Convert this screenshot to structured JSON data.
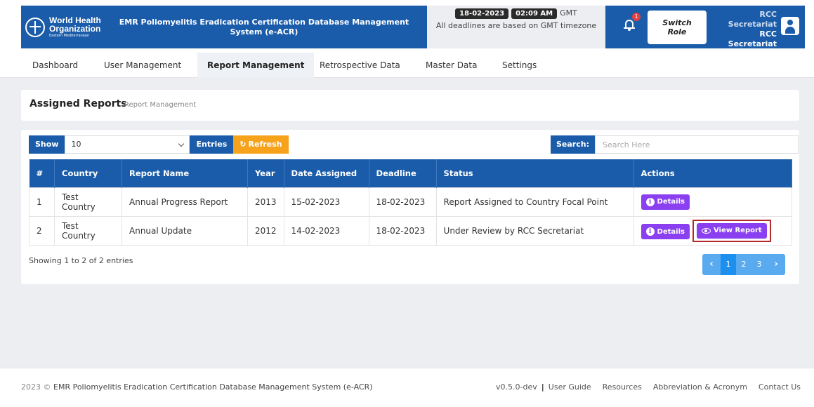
{
  "header": {
    "org": {
      "line1": "World Health",
      "line2": "Organization",
      "region": "Eastern Mediterranean"
    },
    "app_title": "EMR Poliomyelitis Eradication Certification Database Management System (e-ACR)",
    "deadline": {
      "date": "18-02-2023",
      "time": "02:09 AM",
      "tz": "GMT",
      "note": "All deadlines are based on GMT timezone"
    },
    "notifications_count": "1",
    "switch_role_label": "Switch Role",
    "user": {
      "role_title": "RCC Secretariat",
      "name": "RCC Secretariat"
    }
  },
  "nav": {
    "items": [
      {
        "label": "Dashboard"
      },
      {
        "label": "User Management"
      },
      {
        "label": "Report Management"
      },
      {
        "label": "Retrospective Data"
      },
      {
        "label": "Master Data"
      },
      {
        "label": "Settings"
      }
    ],
    "active": "Report Management"
  },
  "page": {
    "title": "Assigned Reports",
    "breadcrumb": "Report Management"
  },
  "table_tools": {
    "show_label": "Show",
    "page_size": "10",
    "entries_label": "Entries",
    "refresh_label": "Refresh",
    "search_label": "Search:",
    "search_placeholder": "Search Here"
  },
  "table": {
    "columns": [
      "#",
      "Country",
      "Report Name",
      "Year",
      "Date Assigned",
      "Deadline",
      "Status",
      "Actions"
    ],
    "rows": [
      {
        "num": "1",
        "country": "Test Country",
        "report": "Annual Progress Report",
        "year": "2013",
        "assigned": "15-02-2023",
        "deadline": "18-02-2023",
        "status": "Report Assigned to Country Focal Point",
        "details": "Details"
      },
      {
        "num": "2",
        "country": "Test Country",
        "report": "Annual Update",
        "year": "2012",
        "assigned": "14-02-2023",
        "deadline": "18-02-2023",
        "status": "Under Review by RCC Secretariat",
        "details": "Details",
        "view": "View Report"
      }
    ]
  },
  "pagination": {
    "summary": "Showing 1 to 2 of 2 entries",
    "prev": "‹",
    "pages": [
      "1",
      "2",
      "3"
    ],
    "next": "›"
  },
  "footer": {
    "year": "2023 ©",
    "system": "EMR Poliomyelitis Eradication Certification Database Management System (e-ACR)",
    "version": "v0.5.0-dev",
    "links": [
      "User Guide",
      "Resources",
      "Abbreviation & Acronym",
      "Contact Us"
    ]
  },
  "colors": {
    "primary": "#1a5ca9",
    "accent_orange": "#f7a21b",
    "action_purple": "#8a3ff0",
    "highlight_red": "#b32a2a"
  }
}
